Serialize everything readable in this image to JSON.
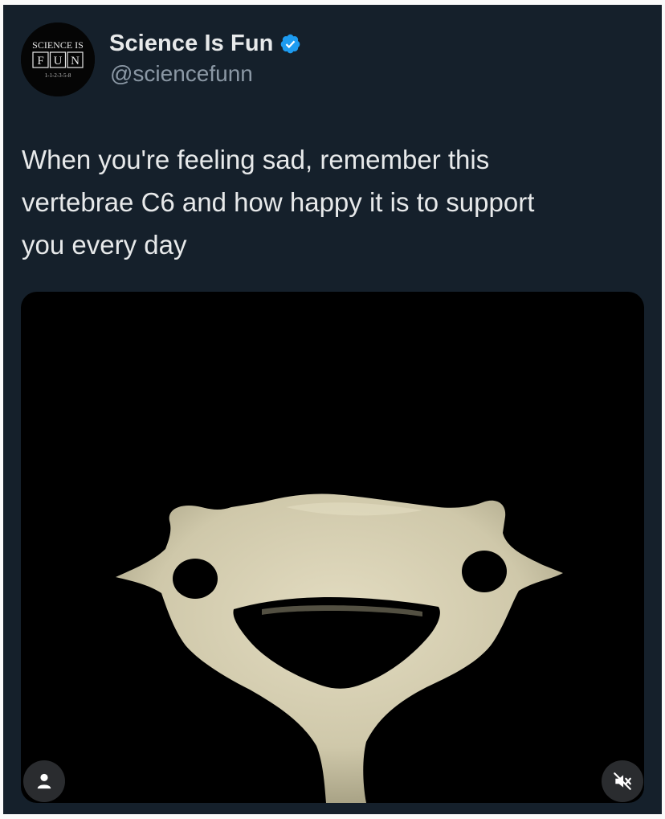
{
  "author": {
    "display_name": "Science Is Fun",
    "handle": "@sciencefunn",
    "avatar_logo": {
      "line1": "SCIENCE IS",
      "line2_letters": [
        "F",
        "U",
        "N"
      ],
      "line3": "1-1-2-3-5-8"
    },
    "verified_icon": "verified-badge-icon"
  },
  "tweet": {
    "text_lines": [
      "When you're feeling sad, remember this",
      "vertebrae C6 and how happy it is to support",
      "you every day"
    ]
  },
  "media": {
    "subject": "cervical-vertebra-c6-photo",
    "controls": {
      "tag_icon": "person-icon",
      "sound_icon": "muted-speaker-icon"
    }
  },
  "colors": {
    "card_background": "#15202b",
    "primary_text": "#e7e9ea",
    "secondary_text": "#8b98a5",
    "verified_blue": "#1d9bf0",
    "bone": "#d8d1b4"
  }
}
